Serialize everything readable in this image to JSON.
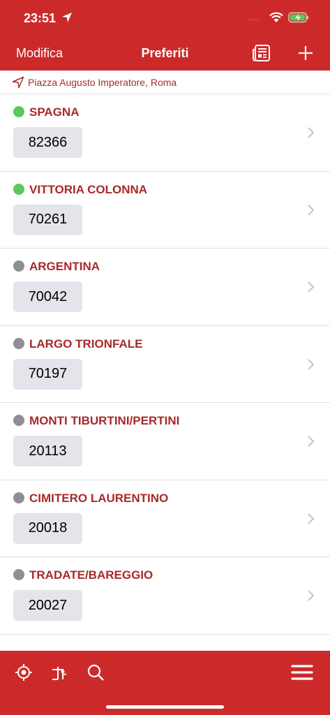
{
  "status_bar": {
    "time": "23:51",
    "signal_dots": "....",
    "icons": [
      "location-arrow-icon",
      "wifi-icon",
      "battery-charging-icon"
    ]
  },
  "nav": {
    "edit_label": "Modifica",
    "title": "Preferiti",
    "icons": [
      "news-icon",
      "add-icon"
    ]
  },
  "location": {
    "icon": "location-arrow-icon",
    "address": "Piazza Augusto Imperatore, Roma"
  },
  "stops": [
    {
      "name": "SPAGNA",
      "code": "82366",
      "status": "active",
      "dot_color": "#5ac95a"
    },
    {
      "name": "VITTORIA COLONNA",
      "code": "70261",
      "status": "active",
      "dot_color": "#5ac95a"
    },
    {
      "name": "ARGENTINA",
      "code": "70042",
      "status": "inactive",
      "dot_color": "#8e8e93"
    },
    {
      "name": "LARGO TRIONFALE",
      "code": "70197",
      "status": "inactive",
      "dot_color": "#8e8e93"
    },
    {
      "name": "MONTI TIBURTINI/PERTINI",
      "code": "20113",
      "status": "inactive",
      "dot_color": "#8e8e93"
    },
    {
      "name": "CIMITERO LAURENTINO",
      "code": "20018",
      "status": "inactive",
      "dot_color": "#8e8e93"
    },
    {
      "name": "TRADATE/BAREGGIO",
      "code": "20027",
      "status": "inactive",
      "dot_color": "#8e8e93"
    }
  ],
  "tabbar": {
    "icons": [
      "locate-icon",
      "route-icon",
      "search-icon",
      "menu-icon"
    ]
  },
  "colors": {
    "brand": "#cc2a2a",
    "stop_name": "#a72a2a",
    "code_background": "#e4e4ea"
  }
}
